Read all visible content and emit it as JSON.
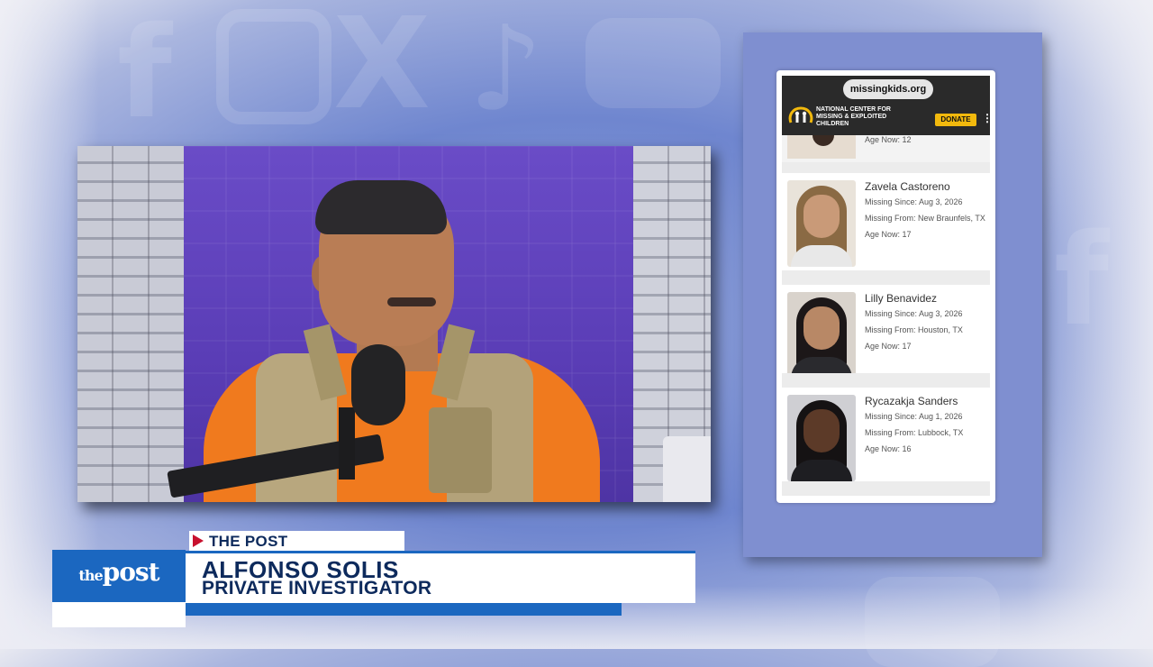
{
  "background": {
    "icons": [
      "facebook-icon",
      "instagram-icon",
      "x-icon",
      "tiktok-icon",
      "youtube-icon"
    ]
  },
  "video": {
    "subject": "interview guest at microphone"
  },
  "phone": {
    "url": "missingkids.org",
    "org_name": "NATIONAL CENTER FOR MISSING & EXPLOITED CHILDREN",
    "donate_label": "DONATE",
    "menu_glyph": "⋮",
    "top_card_age": "Age Now: 12",
    "children": [
      {
        "name": "Zavela Castoreno",
        "missing_since": "Missing Since: Aug 3, 2026",
        "missing_from": "Missing From: New Braunfels, TX",
        "age_now": "Age Now: 17"
      },
      {
        "name": "Lilly Benavidez",
        "missing_since": "Missing Since: Aug 3, 2026",
        "missing_from": "Missing From: Houston, TX",
        "age_now": "Age Now: 17"
      },
      {
        "name": "Rycazakja Sanders",
        "missing_since": "Missing Since: Aug 1, 2026",
        "missing_from": "Missing From: Lubbock, TX",
        "age_now": "Age Now: 16"
      }
    ]
  },
  "lower_third": {
    "logo_the": "the",
    "logo_post": "post",
    "tag": "THE POST",
    "name": "ALFONSO SOLIS",
    "role": "PRIVATE INVESTIGATOR"
  },
  "colors": {
    "brand_blue": "#1b67c0",
    "navy_text": "#0d2a5c",
    "tag_red": "#c8102e",
    "donate_yellow": "#f2b90d"
  }
}
